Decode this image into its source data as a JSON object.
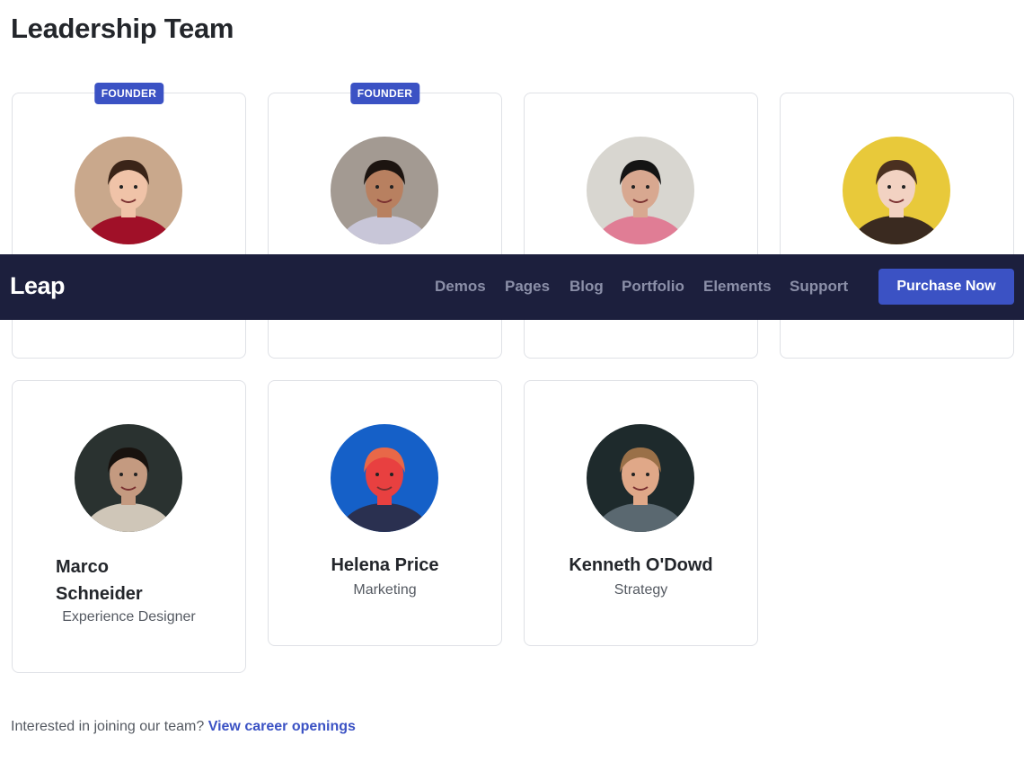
{
  "page": {
    "title": "Leadership Team"
  },
  "navbar": {
    "brand": "Leap",
    "items": [
      "Demos",
      "Pages",
      "Blog",
      "Portfolio",
      "Elements",
      "Support"
    ],
    "cta": "Purchase Now"
  },
  "team": [
    {
      "name": "",
      "role": "",
      "badge": "FOUNDER",
      "avatar_bg": "#c9a88c",
      "shirt": "#a01028",
      "hair": "#3a2418",
      "skin": "#f0c3a8"
    },
    {
      "name": "",
      "role": "",
      "badge": "FOUNDER",
      "avatar_bg": "#a39a92",
      "shirt": "#c8c6d8",
      "hair": "#1c1410",
      "skin": "#b88060"
    },
    {
      "name": "",
      "role": "",
      "badge": "",
      "avatar_bg": "#d8d6d0",
      "shirt": "#e07d95",
      "hair": "#141414",
      "skin": "#d8a890"
    },
    {
      "name": "",
      "role": "",
      "badge": "",
      "avatar_bg": "#e8c93a",
      "shirt": "#3a2a20",
      "hair": "#4a3020",
      "skin": "#f2d2c2"
    },
    {
      "name": "Marco Schneider",
      "role": "Experience Designer",
      "badge": "",
      "avatar_bg": "#2a3230",
      "shirt": "#cfc6b8",
      "hair": "#18120e",
      "skin": "#c49a80"
    },
    {
      "name": "Helena Price",
      "role": "Marketing",
      "badge": "",
      "avatar_bg": "#1560c8",
      "shirt": "#2a3050",
      "hair": "#e86848",
      "skin": "#e84040"
    },
    {
      "name": "Kenneth O'Dowd",
      "role": "Strategy",
      "badge": "",
      "avatar_bg": "#1e2a2c",
      "shirt": "#5a6870",
      "hair": "#9a7048",
      "skin": "#e0a888"
    }
  ],
  "footer": {
    "text": "Interested in joining our team?",
    "link": "View career openings"
  }
}
